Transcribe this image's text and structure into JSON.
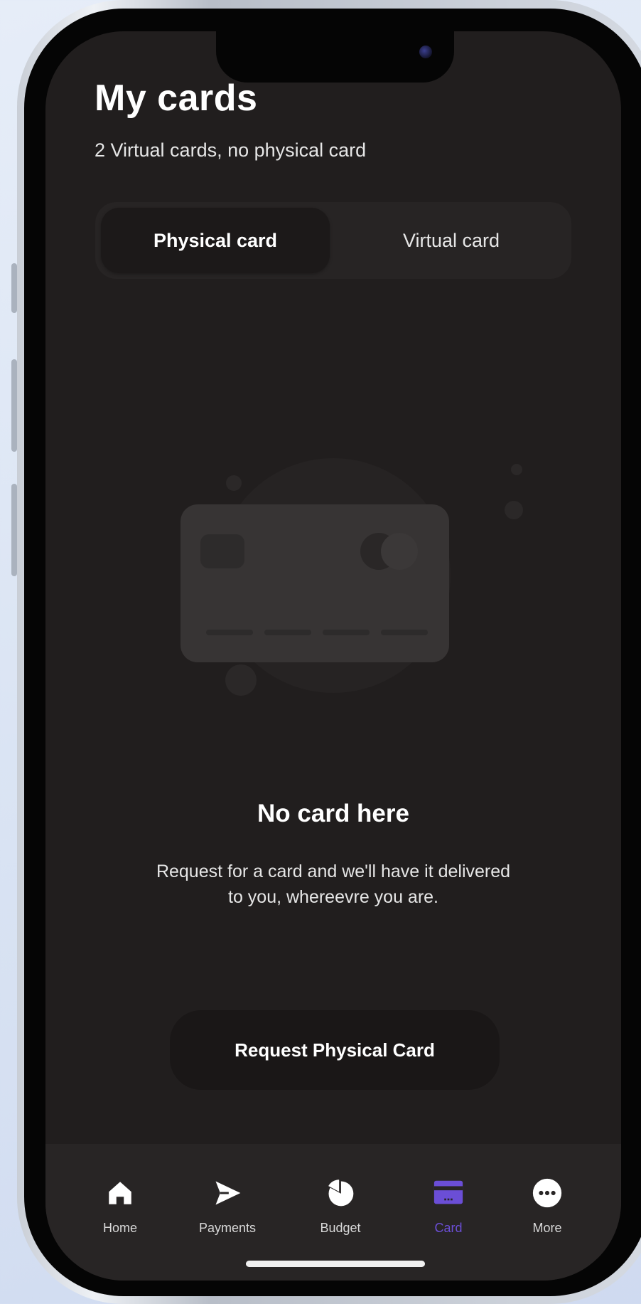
{
  "header": {
    "title": "My cards",
    "subtitle": "2 Virtual cards, no physical card"
  },
  "tabs": [
    {
      "label": "Physical card",
      "active": true
    },
    {
      "label": "Virtual card",
      "active": false
    }
  ],
  "empty_state": {
    "illustration": "credit-card-illustration",
    "title": "No card here",
    "description": "Request for a card and we'll have it delivered to you, whereevre you are."
  },
  "actions": {
    "request_label": "Request Physical Card"
  },
  "nav": {
    "items": [
      {
        "label": "Home",
        "icon": "home-icon",
        "active": false
      },
      {
        "label": "Payments",
        "icon": "send-icon",
        "active": false
      },
      {
        "label": "Budget",
        "icon": "pie-chart-icon",
        "active": false
      },
      {
        "label": "Card",
        "icon": "card-icon",
        "active": true
      },
      {
        "label": "More",
        "icon": "more-icon",
        "active": false
      }
    ]
  },
  "colors": {
    "accent": "#6b4ed6",
    "background": "#211e1e",
    "nav_background": "#282525"
  }
}
